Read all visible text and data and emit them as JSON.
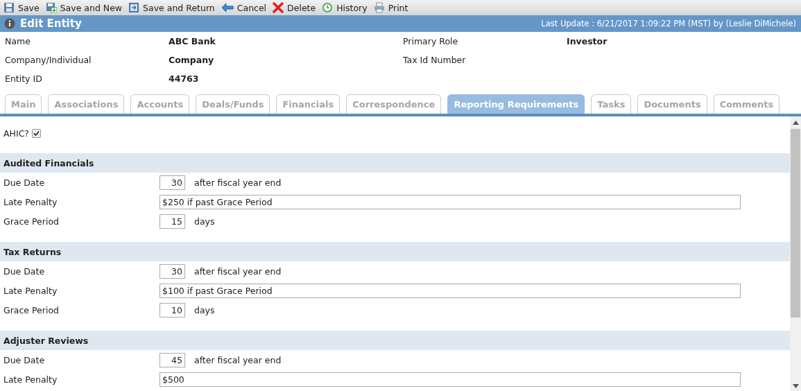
{
  "toolbar": [
    {
      "label": "Save",
      "kind": "save"
    },
    {
      "label": "Save and New",
      "kind": "new"
    },
    {
      "label": "Save and Return",
      "kind": "return"
    },
    {
      "label": "Cancel",
      "kind": "cancel"
    },
    {
      "label": "Delete",
      "kind": "delete"
    },
    {
      "label": "History",
      "kind": "history"
    },
    {
      "label": "Print",
      "kind": "print"
    }
  ],
  "header": {
    "title": "Edit Entity",
    "last_update": "Last Update : 6/21/2017 1:09:22 PM (MST) by (Leslie DiMichele)"
  },
  "info": [
    {
      "label": "Name",
      "value": "ABC Bank"
    },
    {
      "label": "Primary Role",
      "value": "Investor"
    },
    {
      "label": "Company/Individual",
      "value": "Company"
    },
    {
      "label": "Tax Id Number"
    },
    {
      "label": "Entity ID",
      "value": "44763"
    }
  ],
  "tabs": [
    {
      "label": "Main",
      "selected": false
    },
    {
      "label": "Associations",
      "selected": false
    },
    {
      "label": "Accounts",
      "selected": false
    },
    {
      "label": "Deals/Funds",
      "selected": false
    },
    {
      "label": "Financials",
      "selected": false
    },
    {
      "label": "Correspondence",
      "selected": false
    },
    {
      "label": "Reporting Requirements",
      "selected": true
    },
    {
      "label": "Tasks",
      "selected": false
    },
    {
      "label": "Documents",
      "selected": false
    },
    {
      "label": "Comments",
      "selected": false
    }
  ],
  "ahic": {
    "label": "AHIC?",
    "checked": true
  },
  "sections": [
    {
      "title": "Audited Financials",
      "rows": [
        {
          "kind": "short",
          "label": "Due Date",
          "value": "30",
          "suffix": "after fiscal year end"
        },
        {
          "kind": "long",
          "label": "Late Penalty",
          "value": "$250 if past Grace Period"
        },
        {
          "kind": "short",
          "label": "Grace Period",
          "value": "15",
          "suffix": "days"
        }
      ]
    },
    {
      "title": "Tax Returns",
      "rows": [
        {
          "kind": "short",
          "label": "Due Date",
          "value": "30",
          "suffix": "after fiscal year end"
        },
        {
          "kind": "long",
          "label": "Late Penalty",
          "value": "$100 if past Grace Period"
        },
        {
          "kind": "short",
          "label": "Grace Period",
          "value": "10",
          "suffix": "days"
        }
      ]
    },
    {
      "title": "Adjuster Reviews",
      "rows": [
        {
          "kind": "short",
          "label": "Due Date",
          "value": "45",
          "suffix": "after fiscal year end"
        },
        {
          "kind": "long",
          "label": "Late Penalty",
          "value": "$500"
        }
      ]
    }
  ]
}
